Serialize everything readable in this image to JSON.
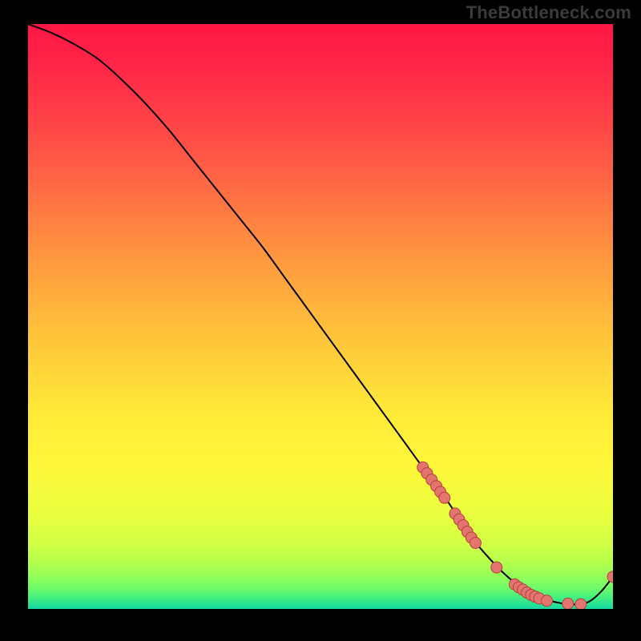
{
  "watermark": "TheBottleneck.com",
  "colors": {
    "page_bg": "#000000",
    "watermark": "#3b3b3b",
    "curve": "#000000",
    "marker_fill": "#e2766e",
    "marker_stroke": "#b93f3f",
    "gradient_stops": [
      {
        "offset": 0.0,
        "color": "#ff1744"
      },
      {
        "offset": 0.06,
        "color": "#ff2347"
      },
      {
        "offset": 0.14,
        "color": "#ff3a47"
      },
      {
        "offset": 0.22,
        "color": "#ff5546"
      },
      {
        "offset": 0.32,
        "color": "#ff7a42"
      },
      {
        "offset": 0.42,
        "color": "#ff9e3e"
      },
      {
        "offset": 0.54,
        "color": "#ffc63a"
      },
      {
        "offset": 0.66,
        "color": "#ffe938"
      },
      {
        "offset": 0.76,
        "color": "#fff83a"
      },
      {
        "offset": 0.84,
        "color": "#e8ff3f"
      },
      {
        "offset": 0.885,
        "color": "#d4ff44"
      },
      {
        "offset": 0.918,
        "color": "#b8ff4c"
      },
      {
        "offset": 0.945,
        "color": "#93ff58"
      },
      {
        "offset": 0.965,
        "color": "#6cfb6a"
      },
      {
        "offset": 0.98,
        "color": "#45f080"
      },
      {
        "offset": 0.99,
        "color": "#2ae590"
      },
      {
        "offset": 1.0,
        "color": "#17d8a2"
      }
    ]
  },
  "chart_data": {
    "type": "line",
    "title": "",
    "xlabel": "",
    "ylabel": "",
    "xlim": [
      0,
      100
    ],
    "ylim": [
      0,
      100
    ],
    "grid": false,
    "series": [
      {
        "name": "bottleneck-curve",
        "x": [
          0,
          4,
          8,
          12,
          16,
          20,
          24,
          28,
          32,
          36,
          40,
          44,
          48,
          52,
          56,
          60,
          64,
          68,
          70,
          72,
          74,
          76,
          79,
          82,
          85,
          88,
          91,
          94,
          96,
          98,
          100
        ],
        "y": [
          100,
          98.5,
          96.5,
          94,
          90.5,
          86.5,
          82,
          77,
          72,
          67,
          62,
          56.5,
          51,
          45.5,
          40,
          34.5,
          29,
          23.5,
          21,
          18,
          15,
          12,
          8.5,
          5.5,
          3.3,
          1.8,
          1.0,
          0.8,
          1.3,
          3.0,
          5.5
        ]
      }
    ],
    "markers": [
      {
        "x": 67.5,
        "y": 24.2
      },
      {
        "x": 68.2,
        "y": 23.2
      },
      {
        "x": 69.0,
        "y": 22.1
      },
      {
        "x": 69.8,
        "y": 21.0
      },
      {
        "x": 70.5,
        "y": 20.0
      },
      {
        "x": 71.2,
        "y": 19.0
      },
      {
        "x": 73.0,
        "y": 16.3
      },
      {
        "x": 73.7,
        "y": 15.3
      },
      {
        "x": 74.4,
        "y": 14.3
      },
      {
        "x": 75.1,
        "y": 13.2
      },
      {
        "x": 75.8,
        "y": 12.2
      },
      {
        "x": 76.5,
        "y": 11.3
      },
      {
        "x": 80.1,
        "y": 7.1
      },
      {
        "x": 83.2,
        "y": 4.2
      },
      {
        "x": 83.9,
        "y": 3.7
      },
      {
        "x": 84.6,
        "y": 3.3
      },
      {
        "x": 85.3,
        "y": 2.8
      },
      {
        "x": 86.0,
        "y": 2.4
      },
      {
        "x": 86.7,
        "y": 2.1
      },
      {
        "x": 87.4,
        "y": 1.8
      },
      {
        "x": 88.7,
        "y": 1.4
      },
      {
        "x": 92.3,
        "y": 0.9
      },
      {
        "x": 94.5,
        "y": 0.8
      },
      {
        "x": 100.0,
        "y": 5.5
      }
    ]
  }
}
